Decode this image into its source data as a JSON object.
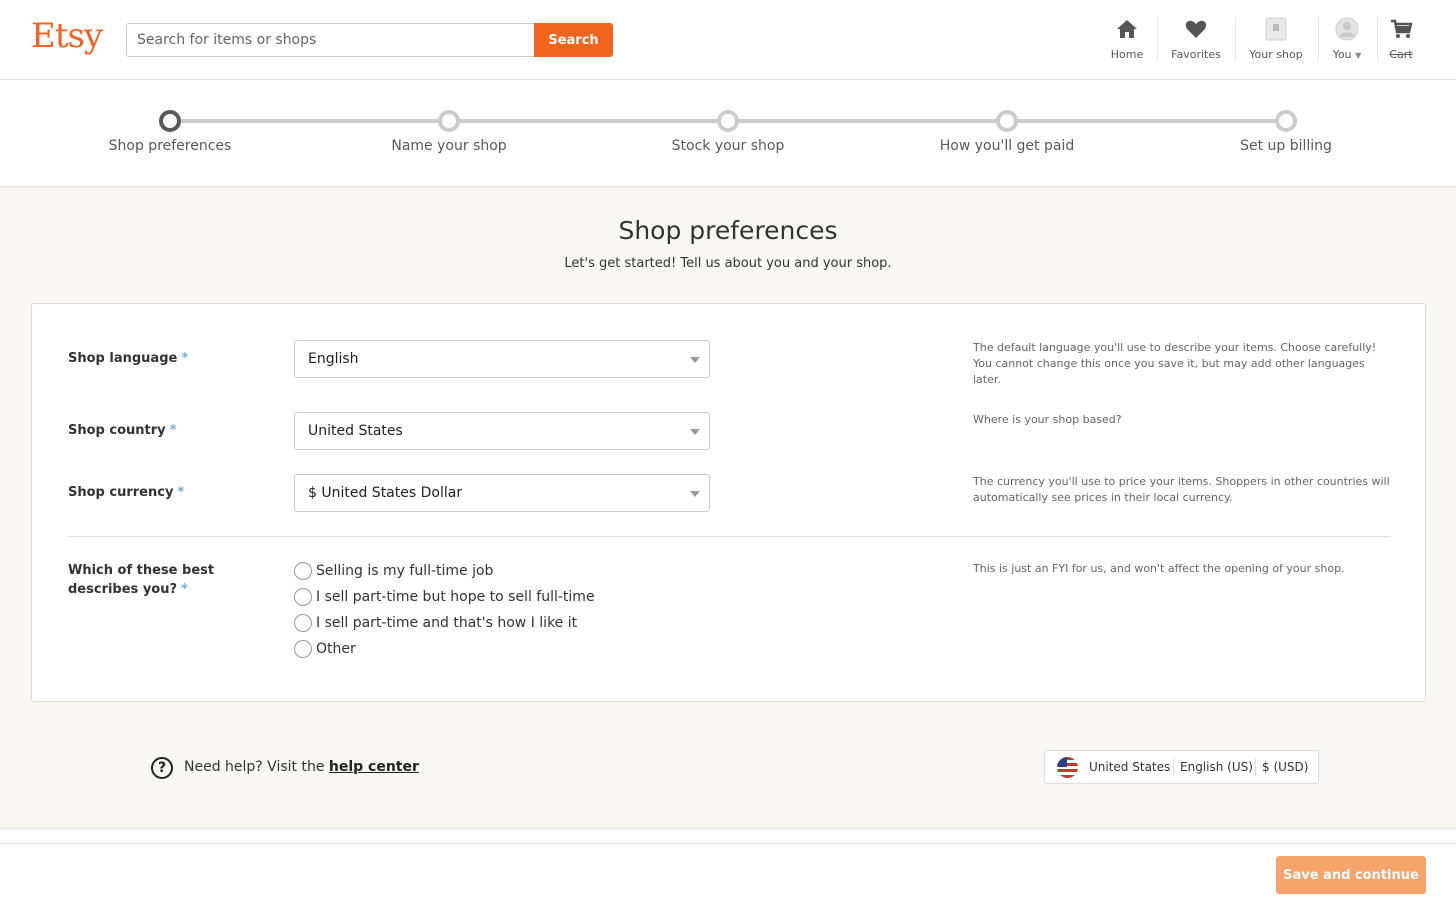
{
  "header": {
    "logo": "Etsy",
    "search_placeholder": "Search for items or shops",
    "search_button": "Search",
    "nav": {
      "home": "Home",
      "favorites": "Favorites",
      "your_shop": "Your shop",
      "you": "You",
      "cart": "Cart"
    }
  },
  "stepper": {
    "steps": [
      {
        "label": "Shop preferences",
        "active": true
      },
      {
        "label": "Name your shop",
        "active": false
      },
      {
        "label": "Stock your shop",
        "active": false
      },
      {
        "label": "How you'll get paid",
        "active": false
      },
      {
        "label": "Set up billing",
        "active": false
      }
    ]
  },
  "main": {
    "title": "Shop preferences",
    "subtitle": "Let's get started! Tell us about you and your shop.",
    "required_mark": "*",
    "fields": {
      "language": {
        "label": "Shop language",
        "value": "English",
        "help": "The default language you'll use to describe your items. Choose carefully! You cannot change this once you save it, but may add other languages later."
      },
      "country": {
        "label": "Shop country",
        "value": "United States",
        "help": "Where is your shop based?"
      },
      "currency": {
        "label": "Shop currency",
        "value": "$ United States Dollar",
        "help": "The currency you'll use to price your items. Shoppers in other countries will automatically see prices in their local currency."
      },
      "describes": {
        "label_line1": "Which of these best",
        "label_line2": "describes you?",
        "help": "This is just an FYI for us, and won't affect the opening of your shop.",
        "options": [
          "Selling is my full-time job",
          "I sell part-time but hope to sell full-time",
          "I sell part-time and that's how I like it",
          "Other"
        ]
      }
    },
    "help_footer": {
      "icon": "?",
      "prefix": "Need help? Visit the ",
      "link": "help center"
    },
    "locale": {
      "country": "United States",
      "language": "English (US)",
      "currency": "$ (USD)"
    }
  },
  "footer": {
    "save_button": "Save and continue"
  },
  "colors": {
    "brand": "#f1641e",
    "save_button": "#f6a46b",
    "required": "#74aed8",
    "page_background": "#f8f7f3"
  }
}
